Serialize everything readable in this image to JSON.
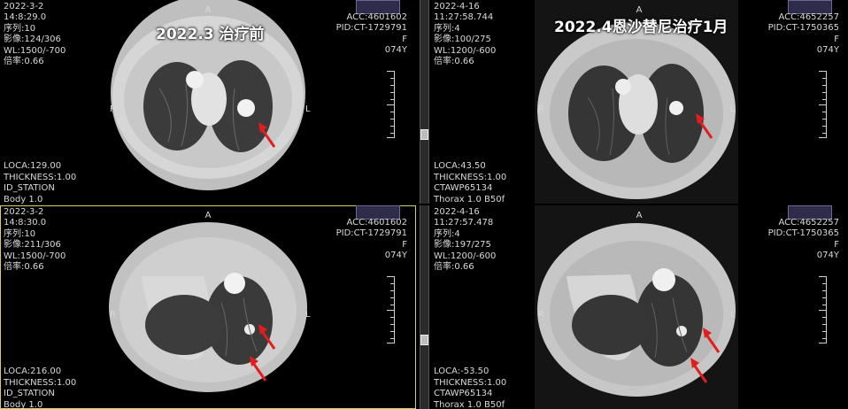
{
  "panes": [
    {
      "id": "tl",
      "top_left": [
        "2022-3-2",
        "14:8:29.0",
        "序列:10",
        "影像:124/306",
        "WL:1500/-700",
        "倍率:0.66"
      ],
      "top_right": [
        "ACC:4601602",
        "PID:CT-1729791",
        "F",
        "074Y"
      ],
      "bottom_left": [
        "LOCA:129.00",
        "THICKNESS:1.00",
        "ID_STATION",
        "Body 1.0"
      ],
      "caption": "2022.3 治疗前",
      "orient": {
        "top": "A",
        "left": "R",
        "right": "L"
      }
    },
    {
      "id": "tr",
      "top_left": [
        "2022-4-16",
        "11:27:58.744",
        "序列:4",
        "影像:100/275",
        "WL:1200/-600",
        "倍率:0.66"
      ],
      "top_right": [
        "ACC:4652257",
        "PID:CT-1750365",
        "F",
        "074Y"
      ],
      "bottom_left": [
        "LOCA:43.50",
        "THICKNESS:1.00",
        "CTAWP65134",
        "Thorax  1.0  B50f"
      ],
      "caption": "2022.4恩沙替尼治疗1月",
      "orient": {
        "top": "A",
        "left": "R",
        "right": "L"
      }
    },
    {
      "id": "bl",
      "top_left": [
        "2022-3-2",
        "14:8:30.0",
        "序列:10",
        "影像:211/306",
        "WL:1500/-700",
        "倍率:0.66"
      ],
      "top_right": [
        "ACC:4601602",
        "PID:CT-1729791",
        "F",
        "074Y"
      ],
      "bottom_left": [
        "LOCA:216.00",
        "THICKNESS:1.00",
        "ID_STATION",
        "Body 1.0"
      ],
      "caption": "",
      "orient": {
        "top": "A",
        "left": "R",
        "right": "L"
      }
    },
    {
      "id": "br",
      "top_left": [
        "2022-4-16",
        "11:27:57.478",
        "序列:4",
        "影像:197/275",
        "WL:1200/-600",
        "倍率:0.66"
      ],
      "top_right": [
        "ACC:4652257",
        "PID:CT-1750365",
        "F",
        "074Y"
      ],
      "bottom_left": [
        "LOCA:-53.50",
        "THICKNESS:1.00",
        "CTAWP65134",
        "Thorax  1.0  B50f"
      ],
      "caption": "",
      "orient": {
        "top": "A",
        "left": "R",
        "right": "L"
      }
    }
  ],
  "colors": {
    "selected_border": "#d2d25a",
    "arrow": "#e21d1d",
    "tag": "#2e2c4a"
  }
}
